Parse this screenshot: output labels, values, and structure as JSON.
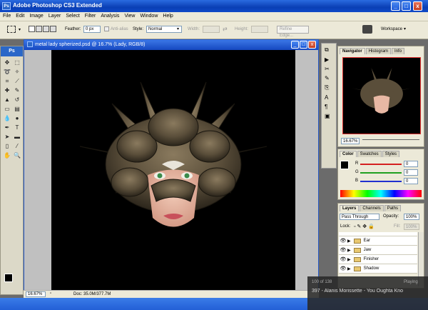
{
  "app": {
    "title": "Adobe Photoshop CS3 Extended",
    "logo": "Ps"
  },
  "window_buttons": {
    "minimize": "_",
    "maximize": "□",
    "close": "x"
  },
  "menu": [
    "File",
    "Edit",
    "Image",
    "Layer",
    "Select",
    "Filter",
    "Analysis",
    "View",
    "Window",
    "Help"
  ],
  "options": {
    "feather_label": "Feather:",
    "feather_value": "0 px",
    "antialias": "Anti-alias",
    "style_label": "Style:",
    "style_value": "Normal",
    "width_label": "Width:",
    "height_label": "Height:",
    "refine": "Refine Edge...",
    "workspace": "Workspace"
  },
  "document": {
    "title": "metal lady spherized.psd @ 16.7% (Lady, RGB/8)",
    "zoom": "16.67%",
    "doc_info": "Doc: 35.0M/377.7M"
  },
  "navigator": {
    "tabs": [
      "Navigator",
      "Histogram",
      "Info"
    ],
    "zoom": "16.67%"
  },
  "color": {
    "tabs": [
      "Color",
      "Swatches",
      "Styles"
    ],
    "channels": [
      {
        "label": "R",
        "value": "0",
        "color": "#d42020"
      },
      {
        "label": "G",
        "value": "0",
        "color": "#20a020"
      },
      {
        "label": "B",
        "value": "0",
        "color": "#2030d0"
      }
    ]
  },
  "layers": {
    "tabs": [
      "Layers",
      "Channels",
      "Paths"
    ],
    "blend": "Pass Through",
    "opacity_label": "Opacity:",
    "opacity": "100%",
    "lock_label": "Lock:",
    "fill_label": "Fill:",
    "fill": "100%",
    "items": [
      "Ear",
      "Jaw",
      "Finisher",
      "Shadow"
    ]
  },
  "music": {
    "counter": "100 of 138",
    "status": "Playing",
    "track": "397 - Alanis Morissette - You Oughta Kno"
  }
}
